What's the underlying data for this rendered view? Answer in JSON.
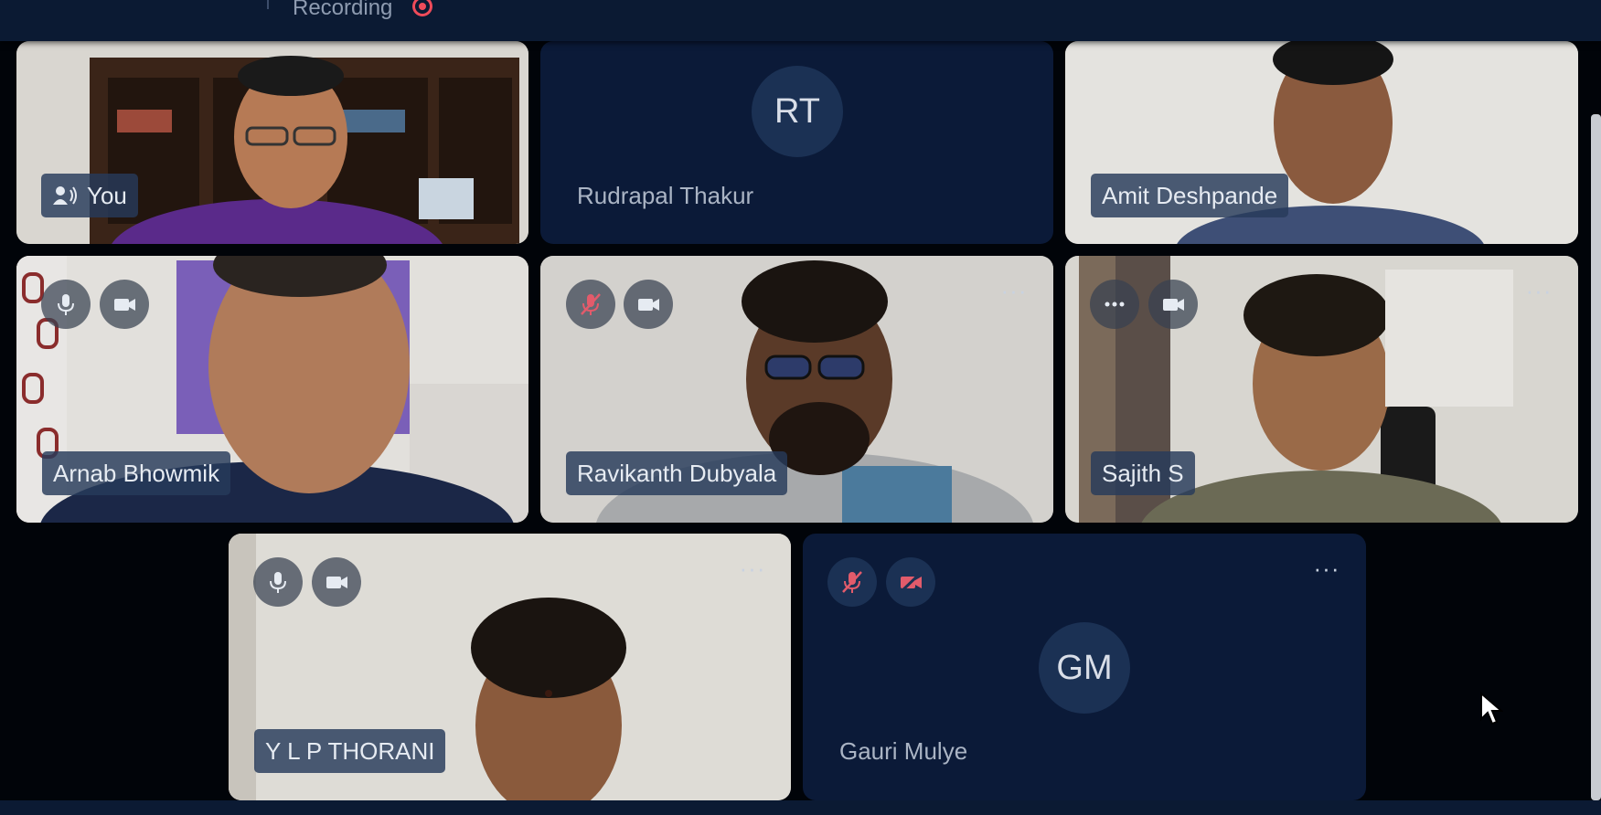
{
  "header": {
    "recording_label": "Recording"
  },
  "participants": [
    {
      "name": "You",
      "initials": "",
      "speaking": true
    },
    {
      "name": "Rudrapal Thakur",
      "initials": "RT"
    },
    {
      "name": "Amit Deshpande",
      "initials": ""
    },
    {
      "name": "Arnab Bhowmik",
      "mic": "on",
      "camera": "on"
    },
    {
      "name": "Ravikanth Dubyala",
      "mic": "muted",
      "camera": "on"
    },
    {
      "name": "Sajith S",
      "mic": "more",
      "camera": "on"
    },
    {
      "name": "Y L P THORANI",
      "mic": "on",
      "camera": "on"
    },
    {
      "name": "Gauri Mulye",
      "initials": "GM",
      "mic": "muted",
      "camera": "off"
    }
  ],
  "controls": {
    "more_glyph": "···"
  },
  "colors": {
    "app_bg": "#010409",
    "tile_bg": "#0b1a38",
    "avatar_circle": "#1b3154",
    "recording_red": "#ef4b5a",
    "muted_red": "#e25b6b"
  },
  "icons": [
    "speaker-icon",
    "mic-icon",
    "mic-muted-icon",
    "camera-icon",
    "camera-off-icon",
    "more-icon",
    "recording-icon",
    "cursor-icon"
  ]
}
